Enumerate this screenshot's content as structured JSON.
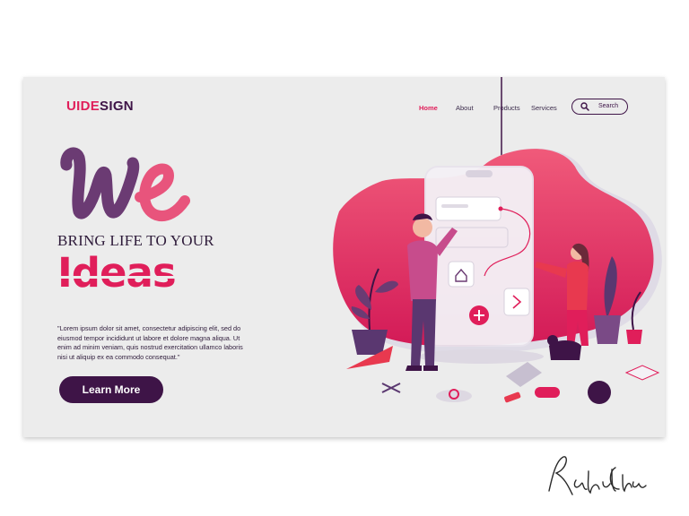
{
  "brand": {
    "logo_part1": "UIDE",
    "logo_part2": "SIGN"
  },
  "nav": {
    "items": [
      "Home",
      "About",
      "Products",
      "Services"
    ],
    "active": "Home"
  },
  "search": {
    "label": "Search",
    "icon": "search-icon"
  },
  "hero": {
    "script_heading": "We",
    "subheading": "BRING LIFE TO YOUR",
    "headline": "Ideas",
    "body": "\"Lorem ipsum dolor sit amet, consectetur adipiscing elit, sed do eiusmod tempor incididunt ut labore et dolore magna aliqua. Ut enim ad minim veniam, quis nostrud exercitation ullamco laboris nisi ut aliquip ex ea commodo consequat.\"",
    "cta_label": "Learn More"
  },
  "signature": {
    "text": "Rahul Chaudary"
  },
  "colors": {
    "accent": "#e01e5a",
    "dark": "#3e1447",
    "background": "#ececec",
    "purple": "#6b3b73",
    "pink": "#e8547c"
  }
}
